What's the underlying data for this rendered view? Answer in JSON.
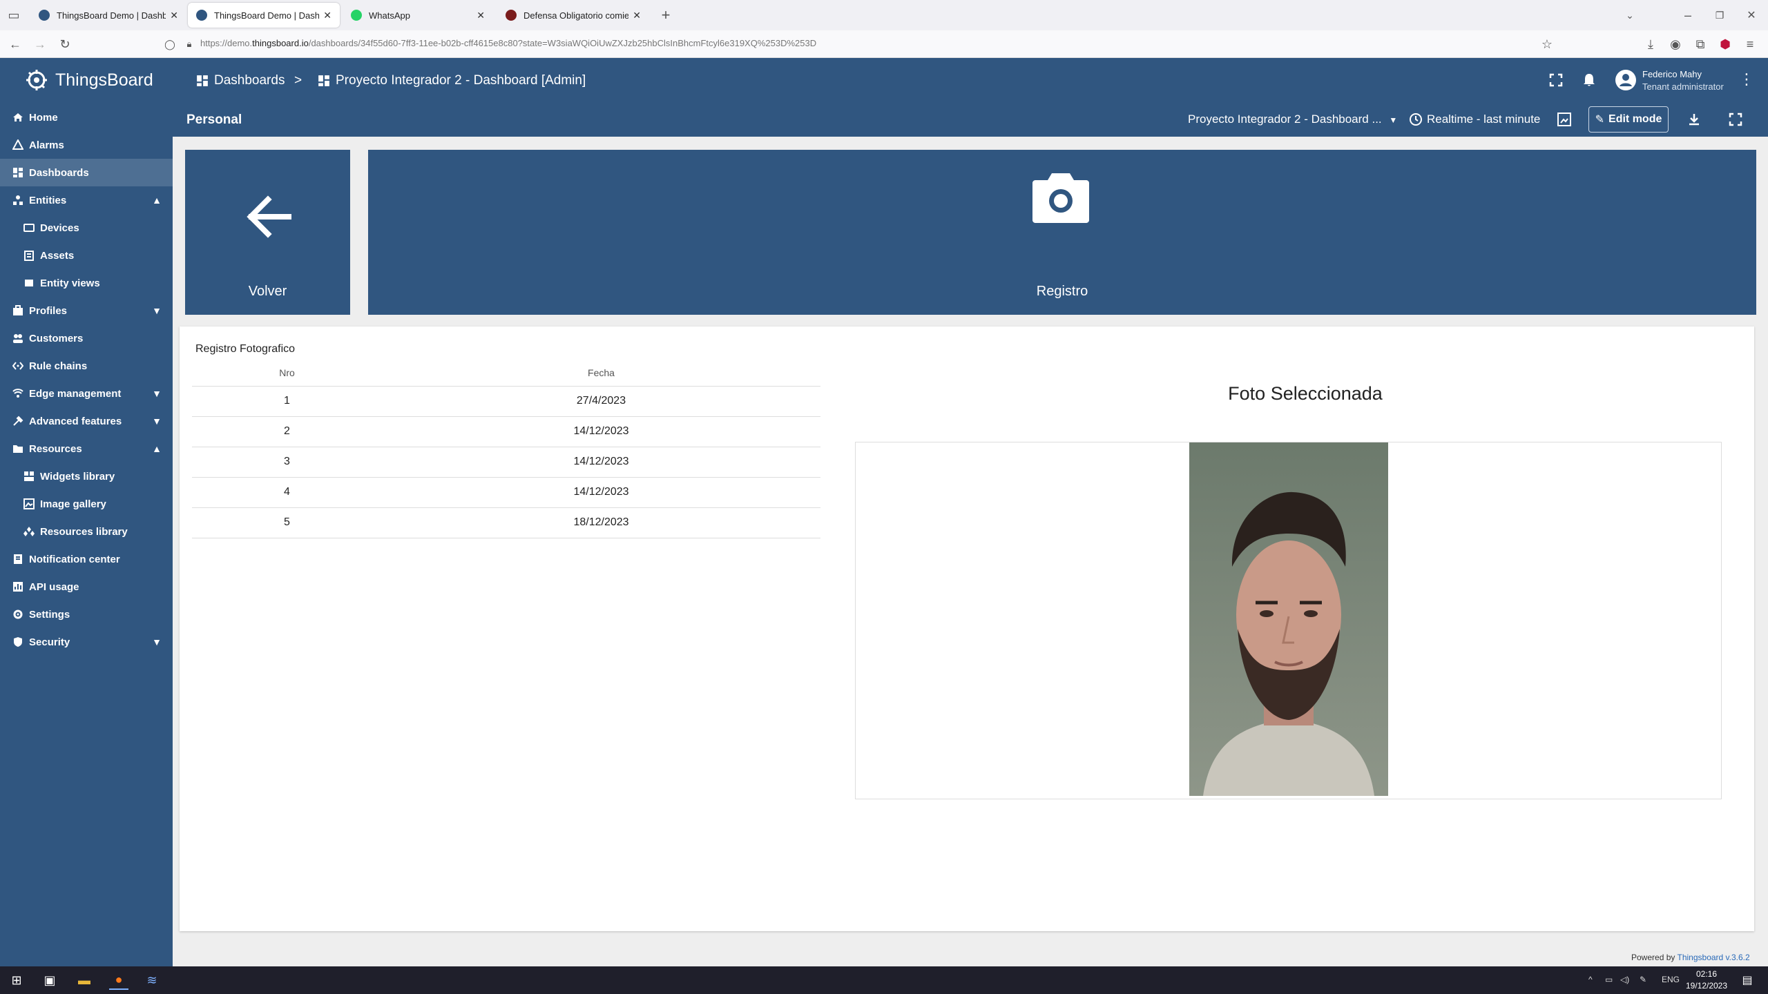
{
  "browser": {
    "tabs": [
      {
        "title": "ThingsBoard Demo | Dashboard",
        "color": "#305680"
      },
      {
        "title": "ThingsBoard Demo | Dashboard",
        "color": "#305680"
      },
      {
        "title": "WhatsApp",
        "color": "#25d366"
      },
      {
        "title": "Defensa Obligatorio comienzo",
        "color": "#7a1c1c"
      }
    ],
    "url_prefix": "https://demo.",
    "url_domain": "thingsboard.io",
    "url_rest": "/dashboards/34f55d60-7ff3-11ee-b02b-cff4615e8c80?state=W3siaWQiOiUwZXJzb25hbClsInBhcmFtcyl6e319XQ%253D%253D"
  },
  "sidebar": {
    "logo": "ThingsBoard",
    "items": [
      {
        "label": "Home",
        "icon": "home-icon"
      },
      {
        "label": "Alarms",
        "icon": "alarm-icon"
      },
      {
        "label": "Dashboards",
        "icon": "dashboards-icon"
      },
      {
        "label": "Entities",
        "icon": "entities-icon"
      },
      {
        "label": "Devices",
        "icon": "devices-icon"
      },
      {
        "label": "Assets",
        "icon": "assets-icon"
      },
      {
        "label": "Entity views",
        "icon": "entity-views-icon"
      },
      {
        "label": "Profiles",
        "icon": "profiles-icon"
      },
      {
        "label": "Customers",
        "icon": "customers-icon"
      },
      {
        "label": "Rule chains",
        "icon": "rule-chains-icon"
      },
      {
        "label": "Edge management",
        "icon": "edge-icon"
      },
      {
        "label": "Advanced features",
        "icon": "advanced-icon"
      },
      {
        "label": "Resources",
        "icon": "resources-icon"
      },
      {
        "label": "Widgets library",
        "icon": "widgets-icon"
      },
      {
        "label": "Image gallery",
        "icon": "image-icon"
      },
      {
        "label": "Resources library",
        "icon": "resources-library-icon"
      },
      {
        "label": "Notification center",
        "icon": "notification-icon"
      },
      {
        "label": "API usage",
        "icon": "api-icon"
      },
      {
        "label": "Settings",
        "icon": "settings-icon"
      },
      {
        "label": "Security",
        "icon": "security-icon"
      }
    ]
  },
  "header": {
    "breadcrumb_root": "Dashboards",
    "breadcrumb_sep": ">",
    "breadcrumb_current": "Proyecto Integrador 2 - Dashboard [Admin]",
    "user_name": "Federico Mahy",
    "user_role": "Tenant administrator"
  },
  "dashboard": {
    "state_title": "Personal",
    "selector": "Proyecto Integrador 2 - Dashboard ...",
    "timewindow": "Realtime - last minute",
    "edit_label": "Edit mode"
  },
  "tiles": {
    "back_label": "Volver",
    "record_label": "Registro"
  },
  "registro": {
    "title": "Registro Fotografico",
    "columns": [
      "Nro",
      "Fecha"
    ],
    "rows": [
      [
        "1",
        "27/4/2023"
      ],
      [
        "2",
        "14/12/2023"
      ],
      [
        "3",
        "14/12/2023"
      ],
      [
        "4",
        "14/12/2023"
      ],
      [
        "5",
        "18/12/2023"
      ]
    ]
  },
  "foto": {
    "title": "Foto Seleccionada"
  },
  "footer": {
    "text": "Powered by ",
    "link": "Thingsboard v.3.6.2"
  },
  "taskbar": {
    "lang": "ENG",
    "time": "02:16",
    "date": "19/12/2023"
  },
  "colors": {
    "primary": "#305680",
    "accent_link": "#2a6ab8"
  }
}
